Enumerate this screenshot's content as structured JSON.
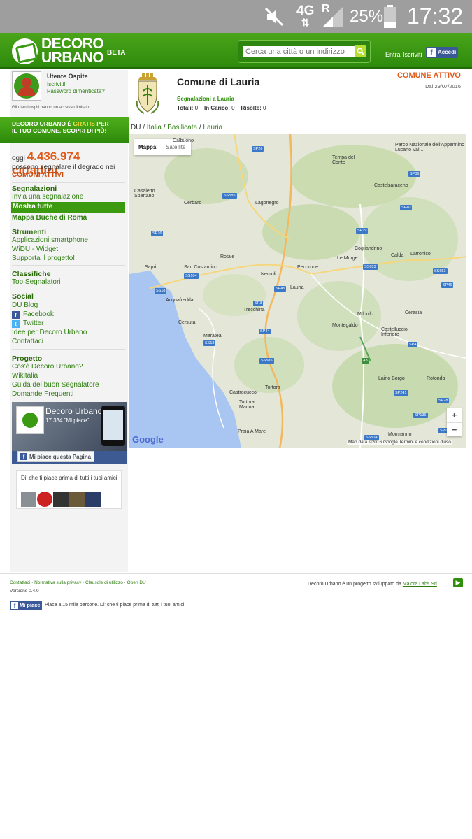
{
  "statusbar": {
    "network": "4G",
    "roaming": "R",
    "battery_pct": "25%",
    "time": "17:32"
  },
  "header": {
    "logo_line1": "DECORO",
    "logo_line2": "URBANO",
    "logo_beta": "BETA",
    "search_placeholder": "Cerca una città o un indirizzo",
    "login_label": "Entra",
    "register_label": "Iscriviti",
    "fb_login_label": "Accedi"
  },
  "user": {
    "name": "Utente Ospite",
    "register_link": "Iscriviti!",
    "forgot_password": "Password dimenticata?",
    "note": "Gli utenti ospiti hanno un accesso limitato."
  },
  "promo": {
    "part1": "DECORO URBANO È ",
    "gratis": "GRATIS",
    "part2": " PER",
    "part3": "IL TUO COMUNE. ",
    "scopri": "SCOPRI DI PIÙ!"
  },
  "citizens": {
    "prefix": "oggi ",
    "count": "4.436.974 cittadini",
    "line2": "possono segnalare il degrado nei",
    "line3": "COMUNI ATTIVI"
  },
  "sidebar": {
    "segnalazioni_title": "Segnalazioni",
    "segnalazioni_items": [
      "Invia una segnalazione",
      "Mostra tutte",
      "Mappa Buche di Roma"
    ],
    "strumenti_title": "Strumenti",
    "strumenti_items": [
      "Applicazioni smartphone",
      "WiDU - Widget",
      "Supporta il progetto!"
    ],
    "classifiche_title": "Classifiche",
    "classifiche_items": [
      "Top Segnalatori"
    ],
    "social_title": "Social",
    "social_items": [
      "DU Blog",
      "Facebook",
      "Twitter",
      "Idee per Decoro Urbano",
      "Contattaci"
    ],
    "progetto_title": "Progetto",
    "progetto_items": [
      "Cos'è Decoro Urbano?",
      "Wikitalia",
      "Guida del buon Segnalatore",
      "Domande Frequenti"
    ]
  },
  "fb_widget": {
    "page_name": "Decoro Urbano",
    "likes": "17.334 \"Mi piace\"",
    "like_button": "Mi piace questa Pagina",
    "friends_text": "Di' che ti piace prima di tutti i tuoi amici"
  },
  "comune": {
    "title": "Comune di Lauria",
    "status": "COMUNE ATTIVO",
    "since": "Dal 29/07/2016",
    "segnalazioni_link": "Segnalazioni a Lauria",
    "totali_label": "Totali:",
    "totali": "0",
    "in_carico_label": "In Carico:",
    "in_carico": "0",
    "risolte_label": "Risolte:",
    "risolte": "0"
  },
  "breadcrumb": [
    "DU",
    "Italia",
    "Basilicata",
    "Lauria"
  ],
  "map": {
    "type_map": "Mappa",
    "type_satellite": "Satellite",
    "google": "Google",
    "attribution": "Map data ©2016 Google  Termini e condizioni d'uso",
    "places": [
      "Calbuono",
      "Tempa del Conte",
      "Parco Nazionale dell'Appennino Lucano Val...",
      "Casaletto Spartano",
      "Cerbaro",
      "Lagonegro",
      "Castelsaraceno",
      "Sapri",
      "San Costantino",
      "Rotale",
      "Nemoli",
      "Pecorone",
      "Le Murge",
      "Cogliandrino",
      "Calda",
      "Latronico",
      "Lauria",
      "Acquafredda",
      "Trecchina",
      "Milordo",
      "Cerasia",
      "Cersuta",
      "Maratea",
      "Montegaldo",
      "Castelluccio Inferiore",
      "Tortora",
      "Castrocucco",
      "Tortora Marina",
      "Laino Borgo",
      "Rotonda",
      "Praia A Mare",
      "Mormanno"
    ],
    "roads": [
      "SP26",
      "SS585",
      "SP16",
      "SS104",
      "SS18",
      "SP3",
      "SP45",
      "SS653",
      "SP46",
      "SP19",
      "SP40",
      "SP36",
      "SS653",
      "SP44",
      "SS18",
      "SS585",
      "A3",
      "SP4",
      "SP28",
      "SP241",
      "SP136",
      "SS504",
      "SP1"
    ]
  },
  "footer": {
    "links": [
      "Contattaci",
      "Normativa sulla privacy",
      "Clausole di utilizzo",
      "Open DU"
    ],
    "version": "Versione 0.4.0",
    "credit_text": "Decoro Urbano è un progetto sviluppato da ",
    "credit_link": "Maiora Labs Srl",
    "fb_like": "Mi piace",
    "fb_text": "Piace a 15 mila persone. Di' che ti piace prima di tutti i tuoi amici."
  },
  "colors": {
    "brand_green": "#3c9a10",
    "accent_orange": "#e05a1a",
    "facebook_blue": "#3b5998"
  }
}
